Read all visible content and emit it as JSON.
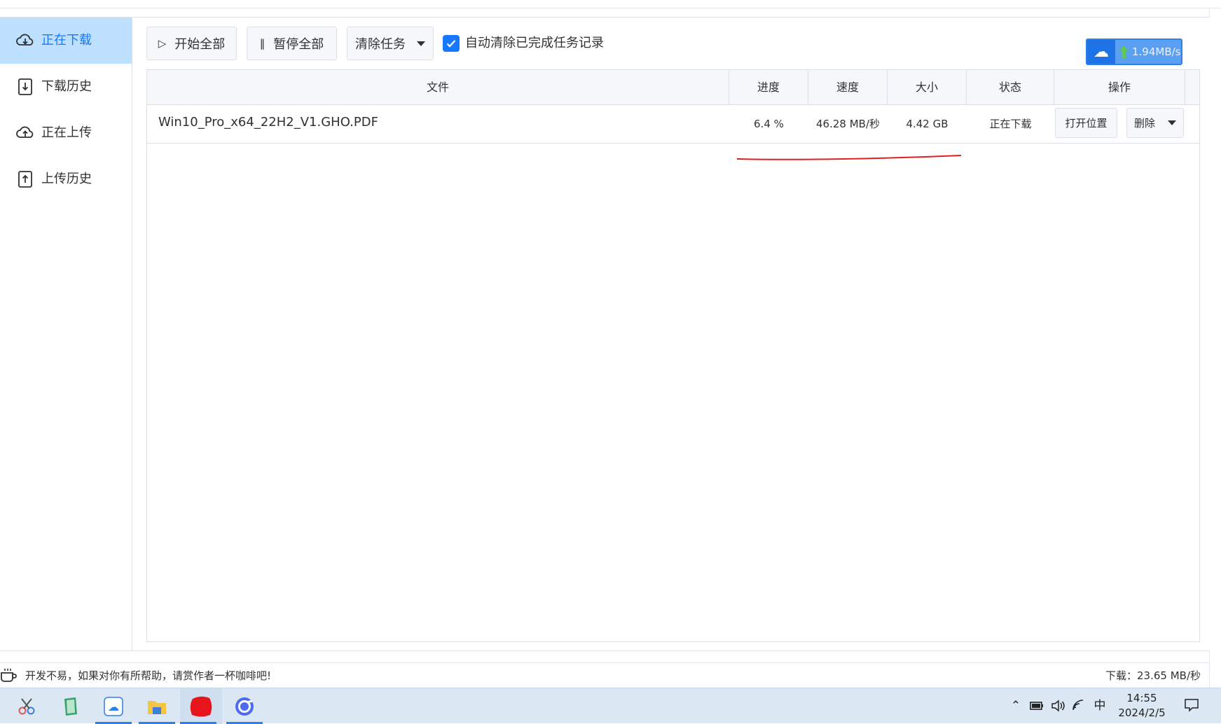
{
  "sidebar": {
    "items": [
      {
        "label": "正在下载",
        "icon": "cloud-download-icon",
        "active": true
      },
      {
        "label": "下载历史",
        "icon": "download-history-icon",
        "active": false
      },
      {
        "label": "正在上传",
        "icon": "cloud-upload-icon",
        "active": false
      },
      {
        "label": "上传历史",
        "icon": "upload-history-icon",
        "active": false
      }
    ]
  },
  "toolbar": {
    "start_all": "开始全部",
    "pause_all": "暂停全部",
    "clear_tasks": "清除任务",
    "auto_clear_label": "自动清除已完成任务记录",
    "auto_clear_checked": true
  },
  "speed_widget": {
    "value": "1.94MB/s"
  },
  "table": {
    "columns": [
      "文件",
      "进度",
      "速度",
      "大小",
      "状态",
      "操作"
    ],
    "rows": [
      {
        "file": "Win10_Pro_x64_22H2_V1.GHO.PDF",
        "progress": "6.4 %",
        "speed": "46.28 MB/秒",
        "size": "4.42 GB",
        "status": "正在下载",
        "open_location": "打开位置",
        "delete": "删除"
      }
    ]
  },
  "statusbar": {
    "message": "开发不易，如果对你有所帮助，请赏作者一杯咖啡吧!",
    "download_speed": "下载：23.65 MB/秒"
  },
  "taskbar": {
    "ime": "中",
    "time": "14:55",
    "date": "2024/2/5"
  },
  "colors": {
    "accent": "#1677ff",
    "active_bg": "#bde0ff",
    "annotation": "#e02020"
  }
}
